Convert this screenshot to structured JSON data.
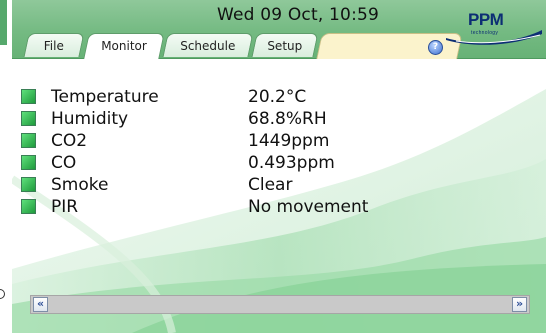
{
  "header": {
    "clock": "Wed 09 Oct, 10:59",
    "logo_text": "PPM",
    "logo_sub": "technology",
    "help_icon": "question-circle-icon"
  },
  "tabs": [
    {
      "label": "File",
      "active": false
    },
    {
      "label": "Monitor",
      "active": true
    },
    {
      "label": "Schedule",
      "active": false
    },
    {
      "label": "Setup",
      "active": false
    }
  ],
  "monitor": {
    "rows": [
      {
        "label": "Temperature",
        "value": "20.2°C",
        "status_color": "#2fba52"
      },
      {
        "label": "Humidity",
        "value": "68.8%RH",
        "status_color": "#2fba52"
      },
      {
        "label": "CO2",
        "value": "1449ppm",
        "status_color": "#2fba52"
      },
      {
        "label": "CO",
        "value": "0.493ppm",
        "status_color": "#2fba52"
      },
      {
        "label": "Smoke",
        "value": "Clear",
        "status_color": "#2fba52"
      },
      {
        "label": "PIR",
        "value": "No movement",
        "status_color": "#2fba52"
      }
    ]
  },
  "scrollbar": {
    "left_icon": "double-chevron-left-icon",
    "right_icon": "double-chevron-right-icon",
    "left_glyph": "«",
    "right_glyph": "»"
  },
  "colors": {
    "header_green": "#74ba82",
    "status_green": "#2fba52",
    "inactive_tab": "#fbf3cc",
    "logo_blue": "#0c2e74"
  }
}
